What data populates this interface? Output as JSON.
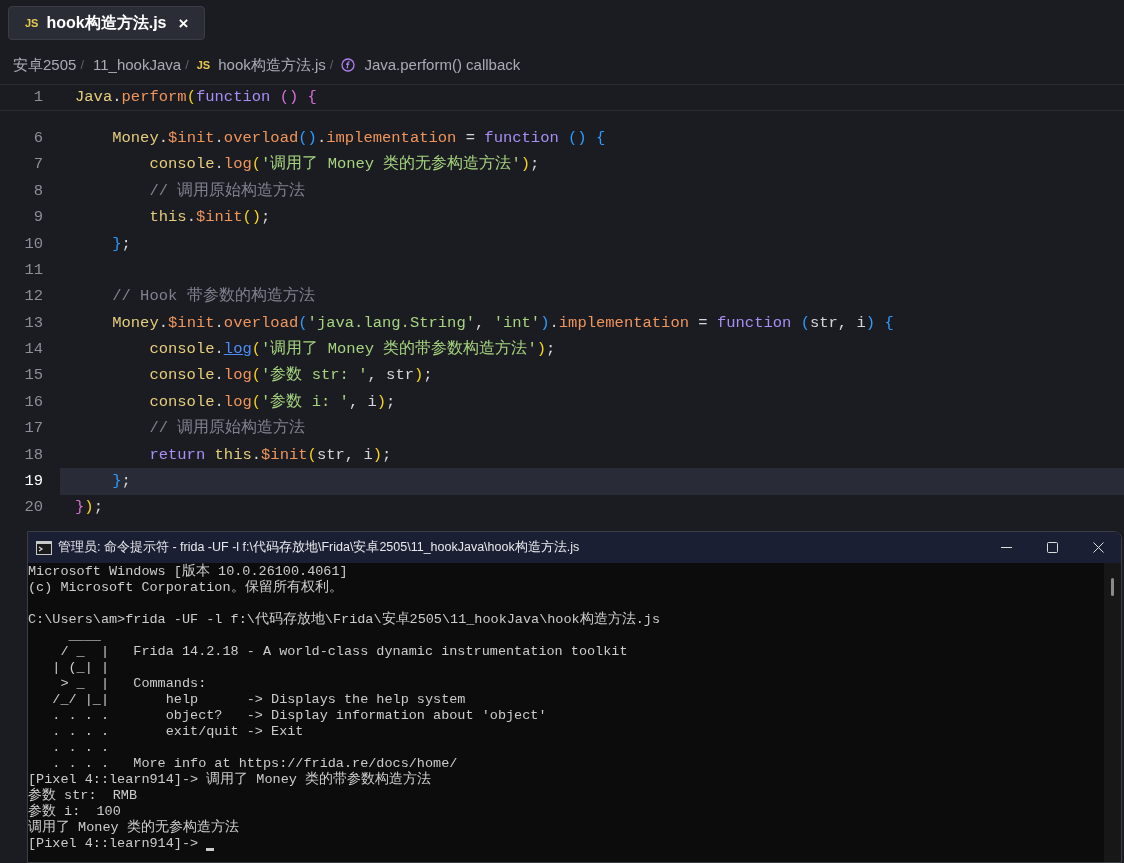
{
  "tabs": [
    {
      "icon": "JS",
      "label": "hook构造方法.js",
      "close": "×",
      "selected": true
    }
  ],
  "breadcrumb": [
    {
      "label": "安卓2505",
      "separator": "/"
    },
    {
      "label": "11_hookJava",
      "separator": "/"
    },
    {
      "label": "hook构造方法.js",
      "icon": "JS",
      "separator": "/"
    },
    {
      "label": "Java.perform() callback",
      "kind": "function"
    }
  ],
  "editor": {
    "sticky_line": {
      "number": "1",
      "tokens": [
        {
          "t": "Java",
          "kind": "obj"
        },
        {
          "t": ".",
          "kind": "p"
        },
        {
          "t": "perform",
          "kind": "fn"
        },
        {
          "t": "(",
          "kind": "b1"
        },
        {
          "t": "function",
          "kind": "kw"
        },
        {
          "t": " ()",
          "kind": "b2"
        },
        {
          "t": " {",
          "kind": "b2"
        }
      ]
    },
    "lines": [
      {
        "number": "6",
        "current": false,
        "tokens": [
          {
            "t": "    Money",
            "kind": "obj"
          },
          {
            "t": ".",
            "kind": "p"
          },
          {
            "t": "$init",
            "kind": "fn"
          },
          {
            "t": ".",
            "kind": "p"
          },
          {
            "t": "overload",
            "kind": "fn"
          },
          {
            "t": "()",
            "kind": "b3"
          },
          {
            "t": ".",
            "kind": "p"
          },
          {
            "t": "implementation",
            "kind": "fn"
          },
          {
            "t": " = ",
            "kind": "p"
          },
          {
            "t": "function",
            "kind": "kw"
          },
          {
            "t": " ()",
            "kind": "b3"
          },
          {
            "t": " {",
            "kind": "b3"
          }
        ]
      },
      {
        "number": "7",
        "current": false,
        "tokens": [
          {
            "t": "        console",
            "kind": "obj"
          },
          {
            "t": ".",
            "kind": "p"
          },
          {
            "t": "log",
            "kind": "fn"
          },
          {
            "t": "(",
            "kind": "b1"
          },
          {
            "t": "'调用了 Money 类的无参构造方法'",
            "kind": "str"
          },
          {
            "t": ")",
            "kind": "b1"
          },
          {
            "t": ";",
            "kind": "p"
          }
        ]
      },
      {
        "number": "8",
        "current": false,
        "tokens": [
          {
            "t": "        // 调用原始构造方法",
            "kind": "cmt"
          }
        ]
      },
      {
        "number": "9",
        "current": false,
        "tokens": [
          {
            "t": "        this",
            "kind": "obj"
          },
          {
            "t": ".",
            "kind": "p"
          },
          {
            "t": "$init",
            "kind": "fn"
          },
          {
            "t": "()",
            "kind": "b1"
          },
          {
            "t": ";",
            "kind": "p"
          }
        ]
      },
      {
        "number": "10",
        "current": false,
        "tokens": [
          {
            "t": "    }",
            "kind": "b3"
          },
          {
            "t": ";",
            "kind": "p"
          }
        ]
      },
      {
        "number": "11",
        "current": false
      },
      {
        "number": "12",
        "current": false,
        "tokens": [
          {
            "t": "    // Hook 带参数的构造方法",
            "kind": "cmt"
          }
        ]
      },
      {
        "number": "13",
        "current": false,
        "tokens": [
          {
            "t": "    Money",
            "kind": "obj"
          },
          {
            "t": ".",
            "kind": "p"
          },
          {
            "t": "$init",
            "kind": "fn"
          },
          {
            "t": ".",
            "kind": "p"
          },
          {
            "t": "overload",
            "kind": "fn"
          },
          {
            "t": "(",
            "kind": "b3"
          },
          {
            "t": "'java.lang.String'",
            "kind": "str"
          },
          {
            "t": ", ",
            "kind": "p"
          },
          {
            "t": "'int'",
            "kind": "str"
          },
          {
            "t": ")",
            "kind": "b3"
          },
          {
            "t": ".",
            "kind": "p"
          },
          {
            "t": "implementation",
            "kind": "fn"
          },
          {
            "t": " = ",
            "kind": "p"
          },
          {
            "t": "function",
            "kind": "kw"
          },
          {
            "t": " (",
            "kind": "b3"
          },
          {
            "t": "str, i",
            "kind": "p"
          },
          {
            "t": ")",
            "kind": "b3"
          },
          {
            "t": " {",
            "kind": "b3"
          }
        ]
      },
      {
        "number": "14",
        "current": false,
        "tokens": [
          {
            "t": "        console",
            "kind": "obj"
          },
          {
            "t": ".",
            "kind": "p"
          },
          {
            "t": "log",
            "kind": "link"
          },
          {
            "t": "(",
            "kind": "b1"
          },
          {
            "t": "'调用了 Money 类的带参数构造方法'",
            "kind": "str"
          },
          {
            "t": ")",
            "kind": "b1"
          },
          {
            "t": ";",
            "kind": "p"
          }
        ]
      },
      {
        "number": "15",
        "current": false,
        "tokens": [
          {
            "t": "        console",
            "kind": "obj"
          },
          {
            "t": ".",
            "kind": "p"
          },
          {
            "t": "log",
            "kind": "fn"
          },
          {
            "t": "(",
            "kind": "b1"
          },
          {
            "t": "'参数 str: '",
            "kind": "str"
          },
          {
            "t": ", str",
            "kind": "p"
          },
          {
            "t": ")",
            "kind": "b1"
          },
          {
            "t": ";",
            "kind": "p"
          }
        ]
      },
      {
        "number": "16",
        "current": false,
        "tokens": [
          {
            "t": "        console",
            "kind": "obj"
          },
          {
            "t": ".",
            "kind": "p"
          },
          {
            "t": "log",
            "kind": "fn"
          },
          {
            "t": "(",
            "kind": "b1"
          },
          {
            "t": "'参数 i: '",
            "kind": "str"
          },
          {
            "t": ", i",
            "kind": "p"
          },
          {
            "t": ")",
            "kind": "b1"
          },
          {
            "t": ";",
            "kind": "p"
          }
        ]
      },
      {
        "number": "17",
        "current": false,
        "tokens": [
          {
            "t": "        // 调用原始构造方法",
            "kind": "cmt"
          }
        ]
      },
      {
        "number": "18",
        "current": false,
        "tokens": [
          {
            "t": "        return",
            "kind": "kw"
          },
          {
            "t": " this",
            "kind": "obj"
          },
          {
            "t": ".",
            "kind": "p"
          },
          {
            "t": "$init",
            "kind": "fn"
          },
          {
            "t": "(",
            "kind": "b1"
          },
          {
            "t": "str, i",
            "kind": "p"
          },
          {
            "t": ")",
            "kind": "b1"
          },
          {
            "t": ";",
            "kind": "p"
          }
        ]
      },
      {
        "number": "19",
        "current": true,
        "tokens": [
          {
            "t": "    }",
            "kind": "b3"
          },
          {
            "t": ";",
            "kind": "p"
          }
        ]
      },
      {
        "number": "20",
        "current": false,
        "tokens": [
          {
            "t": "}",
            "kind": "b2"
          },
          {
            "t": ")",
            "kind": "b1"
          },
          {
            "t": ";",
            "kind": "p"
          }
        ]
      }
    ]
  },
  "terminal": {
    "title": "管理员: 命令提示符 - frida  -UF -l f:\\代码存放地\\Frida\\安卓2505\\11_hookJava\\hook构造方法.js",
    "cursor": true,
    "blocks": [
      [
        "Microsoft Windows [版本 10.0.26100.4061]",
        "(c) Microsoft Corporation。保留所有权利。"
      ],
      [
        "C:\\Users\\am>frida -UF -l f:\\代码存放地\\Frida\\安卓2505\\11_hookJava\\hook构造方法.js",
        "     ____",
        "    / _  |   Frida 14.2.18 - A world-class dynamic instrumentation toolkit",
        "   | (_| |",
        "    > _  |   Commands:",
        "   /_/ |_|       help      -> Displays the help system",
        "   . . . .       object?   -> Display information about 'object'",
        "   . . . .       exit/quit -> Exit",
        "   . . . .",
        "   . . . .   More info at https://frida.re/docs/home/",
        "[Pixel 4::learn914]-> 调用了 Money 类的带参数构造方法",
        "参数 str:  RMB",
        "参数 i:  100",
        "调用了 Money 类的无参构造方法",
        "[Pixel 4::learn914]-> "
      ]
    ]
  }
}
